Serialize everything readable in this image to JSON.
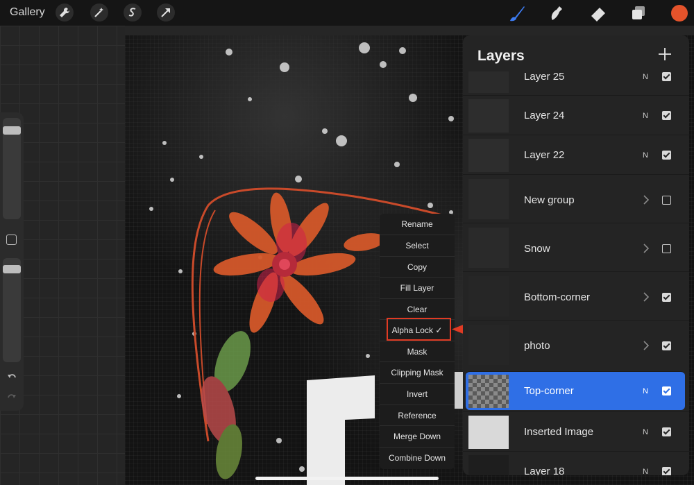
{
  "toolbar": {
    "gallery_label": "Gallery",
    "left_icons": [
      "wrench-icon",
      "magic-wand-icon",
      "selection-s-icon",
      "transform-arrow-icon"
    ],
    "right_icons": [
      "brush-icon",
      "smudge-icon",
      "eraser-icon",
      "layers-icon"
    ],
    "color": "#e4532b"
  },
  "context_menu": {
    "items": [
      "Rename",
      "Select",
      "Copy",
      "Fill Layer",
      "Clear",
      "Alpha Lock ✓",
      "Mask",
      "Clipping Mask",
      "Invert",
      "Reference",
      "Merge Down",
      "Combine Down"
    ],
    "highlight_color": "#e03b24"
  },
  "layers_panel": {
    "title": "Layers",
    "add_label": "+",
    "layers": [
      {
        "name": "Layer 25",
        "mode": "N",
        "visible": true
      },
      {
        "name": "Layer 24",
        "mode": "N",
        "visible": true
      },
      {
        "name": "Layer 22",
        "mode": "N",
        "visible": true
      },
      {
        "name": "New group",
        "mode": "",
        "visible": false
      },
      {
        "name": "Snow",
        "mode": "",
        "visible": false
      },
      {
        "name": "Bottom-corner",
        "mode": "",
        "visible": true
      },
      {
        "name": "photo",
        "mode": "",
        "visible": true
      },
      {
        "name": "Top-corner",
        "mode": "N",
        "visible": true
      },
      {
        "name": "Inserted Image",
        "mode": "N",
        "visible": true
      },
      {
        "name": "Layer 18",
        "mode": "N",
        "visible": true
      }
    ],
    "active_color": "#2f6fe6"
  }
}
